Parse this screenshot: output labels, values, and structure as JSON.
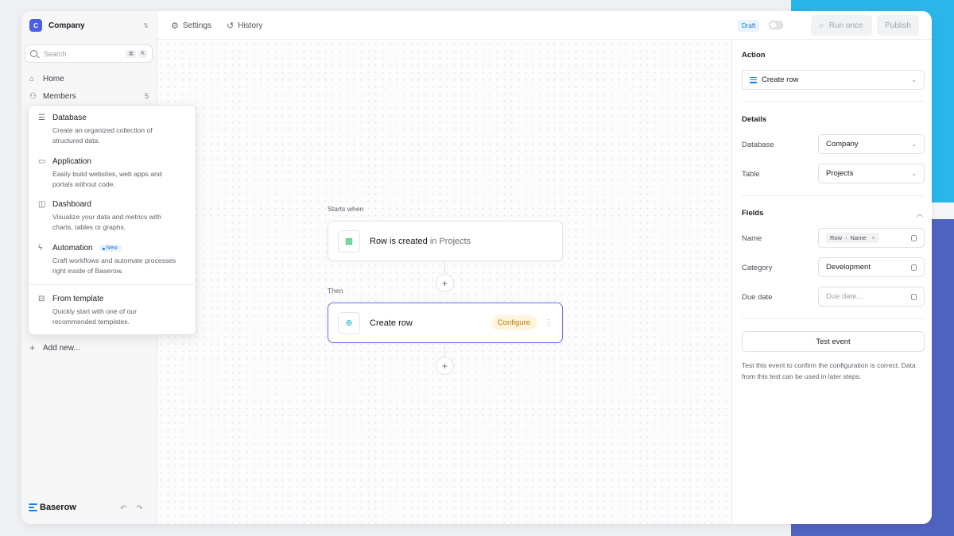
{
  "workspace": {
    "initial": "C",
    "name": "Company"
  },
  "search": {
    "placeholder": "Search",
    "shortcut": [
      "⌘",
      "K"
    ]
  },
  "sidebar": {
    "items": [
      {
        "label": "Home",
        "icon": "home-icon"
      },
      {
        "label": "Members",
        "icon": "members-icon",
        "count": "5"
      }
    ],
    "add_new": "Add new..."
  },
  "create_menu": {
    "items": [
      {
        "title": "Database",
        "desc": "Create an organized collection of structured data.",
        "icon": "database-icon"
      },
      {
        "title": "Application",
        "desc": "Easily build websites, web apps and portals without code.",
        "icon": "application-icon"
      },
      {
        "title": "Dashboard",
        "desc": "Visualize your data and metrics with charts, tables or graphs.",
        "icon": "dashboard-icon"
      },
      {
        "title": "Automation",
        "desc": "Craft workflows and automate processes right inside of Baserow.",
        "icon": "automation-icon",
        "badge": "New"
      },
      {
        "title": "From template",
        "desc": "Quickly start with one of our recommended templates.",
        "icon": "template-icon"
      }
    ]
  },
  "brand": {
    "name": "Baserow"
  },
  "topbar": {
    "settings": "Settings",
    "history": "History",
    "status": "Draft",
    "run_once": "Run once",
    "publish": "Publish"
  },
  "flow": {
    "trigger_label": "Starts when",
    "trigger_title": "Row is created",
    "trigger_sub": "in Projects",
    "then_label": "Then",
    "action_title": "Create row",
    "configure": "Configure"
  },
  "panel": {
    "action_heading": "Action",
    "action_value": "Create row",
    "details_heading": "Details",
    "database_label": "Database",
    "database_value": "Company",
    "table_label": "Table",
    "table_value": "Projects",
    "fields_heading": "Fields",
    "name_label": "Name",
    "name_chip_a": "Row",
    "name_chip_b": "Name",
    "category_label": "Category",
    "category_value": "Development",
    "due_label": "Due date",
    "due_placeholder": "Due date...",
    "test_button": "Test event",
    "help_text": "Test this event to confirm the configuration is correct. Data from this test can be used in later steps."
  },
  "colors": {
    "accent": "#4b5ee8",
    "selected_border": "#6c6ff0",
    "configure_bg": "#fff5dc",
    "configure_text": "#b87b0e",
    "draft_text": "#1a7ad8",
    "bg_cyan": "#2bb6ea",
    "bg_indigo": "#4f63c0"
  }
}
